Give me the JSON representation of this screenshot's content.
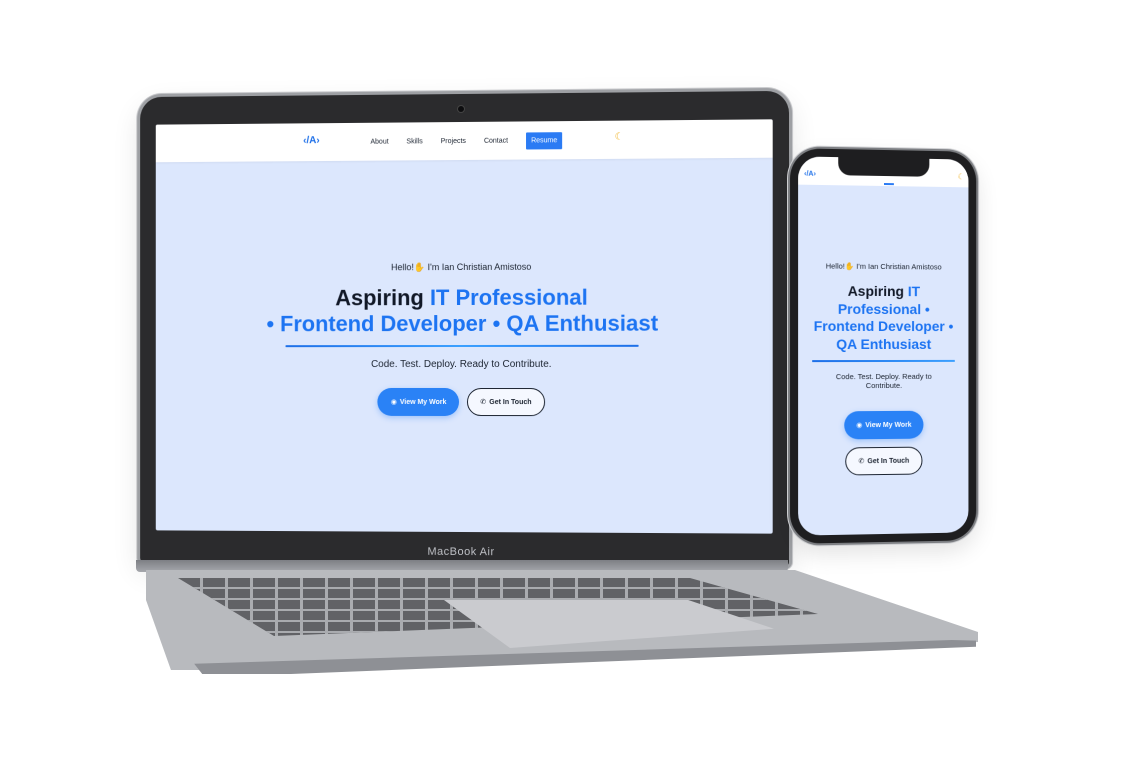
{
  "laptop": {
    "brand_label": "MacBook Air",
    "site": {
      "nav": {
        "logo": "‹/A›",
        "links": [
          "About",
          "Skills",
          "Projects",
          "Contact"
        ],
        "resume_label": "Resume",
        "theme_icon": "moon-icon"
      },
      "hero": {
        "greeting_prefix": "Hello!",
        "greeting_suffix": " I'm Ian Christian Amistoso",
        "title_start": "Aspiring ",
        "title_highlight": "IT Professional",
        "title_rest": "• Frontend Developer • QA Enthusiast",
        "tagline": "Code. Test. Deploy. Ready to Contribute.",
        "primary_button": "View My Work",
        "secondary_button": "Get In Touch"
      }
    }
  },
  "phone": {
    "site": {
      "nav": {
        "logo": "‹/A›",
        "theme_icon": "moon-icon"
      },
      "hero": {
        "greeting_prefix": "Hello!",
        "greeting_suffix": " I'm Ian Christian Amistoso",
        "title_start": "Aspiring ",
        "title_highlight": "IT Professional • Frontend Developer • QA Enthusiast",
        "tagline": "Code. Test. Deploy. Ready to Contribute.",
        "primary_button": "View My Work",
        "secondary_button": "Get In Touch"
      }
    }
  },
  "colors": {
    "accent": "#2b7bf4",
    "hero_background": "#dce7fd",
    "text": "#111827"
  }
}
